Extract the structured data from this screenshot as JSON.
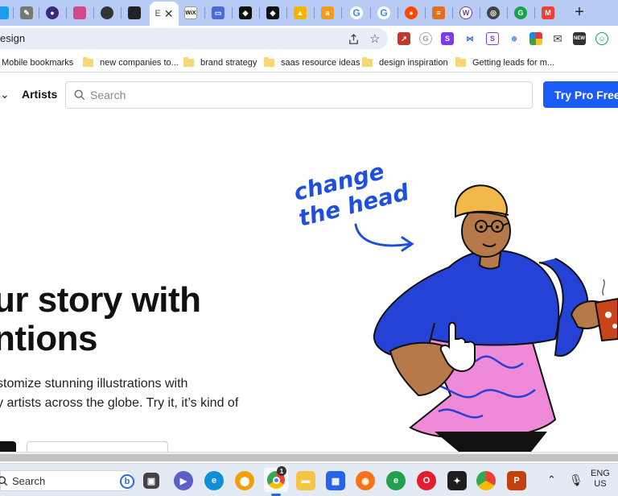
{
  "browser": {
    "address_text": "esign",
    "tabs": [
      {
        "icon": "twitter-icon",
        "color": "#1d9bf0"
      },
      {
        "icon": "feather-icon",
        "color": "#555555"
      },
      {
        "icon": "owl-icon",
        "color": "#3b2a7a"
      },
      {
        "icon": "mascot-icon",
        "color": "#d04a8a"
      },
      {
        "icon": "avatar-icon",
        "color": "#333333"
      },
      {
        "icon": "avatar-icon",
        "color": "#222222"
      },
      {
        "icon": "page-icon",
        "color": "#555555",
        "active": true
      },
      {
        "icon": "wix-icon",
        "color": "#111111"
      },
      {
        "icon": "mail-icon",
        "color": "#4a6bd6"
      },
      {
        "icon": "diamond-icon",
        "color": "#111111"
      },
      {
        "icon": "diamond-icon",
        "color": "#111111"
      },
      {
        "icon": "ads-icon",
        "color": "#f4b400"
      },
      {
        "icon": "amazon-icon",
        "color": "#f79b1e"
      },
      {
        "icon": "google-icon",
        "color": "#4285f4"
      },
      {
        "icon": "google-icon",
        "color": "#4285f4"
      },
      {
        "icon": "reddit-icon",
        "color": "#ff4500"
      },
      {
        "icon": "bookmark-icon",
        "color": "#e07020"
      },
      {
        "icon": "wp-icon",
        "color": "#6b3fa0"
      },
      {
        "icon": "chrome-icon",
        "color": "#444444"
      },
      {
        "icon": "grammarly-icon",
        "color": "#15a34a"
      },
      {
        "icon": "gmail-icon",
        "color": "#ea4335"
      }
    ],
    "bookmarks": [
      {
        "label": "Mobile bookmarks"
      },
      {
        "label": "new companies to..."
      },
      {
        "label": "brand strategy"
      },
      {
        "label": "saas resource ideas"
      },
      {
        "label": "design inspiration"
      },
      {
        "label": "Getting leads for m..."
      }
    ]
  },
  "site": {
    "nav": {
      "artists_label": "Artists"
    },
    "search": {
      "placeholder": "Search"
    },
    "pro_button": "Try Pro Free",
    "hero": {
      "title_line1": "ur story with",
      "title_line2": "ntions",
      "sub_line1": "stomize stunning illustrations with",
      "sub_line2": "y artists across the globe. Try it, it’s kind of"
    },
    "illustration": {
      "annotation_line1": "change",
      "annotation_line2": "the head",
      "colors": {
        "shirt": "#2442d6",
        "skirt": "#ef8ad8",
        "skin": "#b5794a",
        "hat": "#f3b84a",
        "mug": "#c8451c",
        "ink": "#1e4fe0"
      }
    }
  },
  "taskbar": {
    "search_label": "Search",
    "chrome_badge": "1",
    "lang_line1": "ENG",
    "lang_line2": "US"
  }
}
